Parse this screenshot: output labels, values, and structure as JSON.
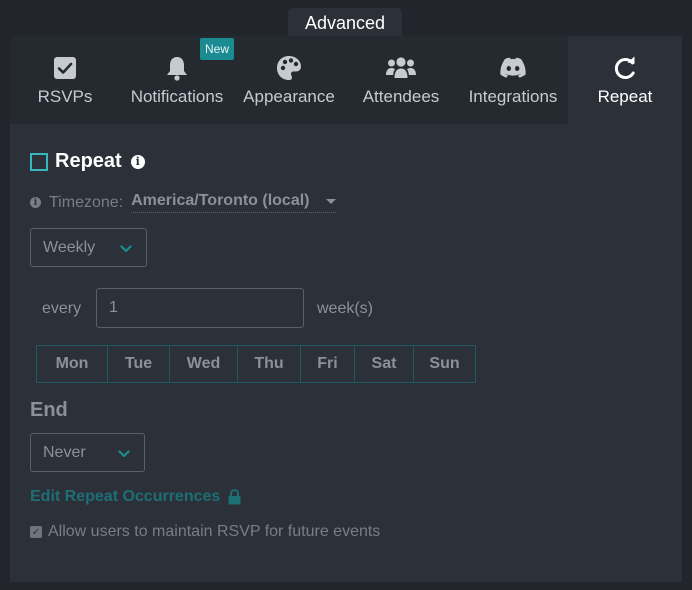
{
  "header": {
    "section_tab": "Advanced"
  },
  "tabs": [
    {
      "label": "RSVPs",
      "icon": "checkbox-icon"
    },
    {
      "label": "Notifications",
      "icon": "bell-icon",
      "badge": "New"
    },
    {
      "label": "Appearance",
      "icon": "palette-icon"
    },
    {
      "label": "Attendees",
      "icon": "users-icon"
    },
    {
      "label": "Integrations",
      "icon": "discord-icon"
    },
    {
      "label": "Repeat",
      "icon": "redo-icon",
      "active": true
    }
  ],
  "repeat": {
    "title": "Repeat",
    "checked": false,
    "info_glyph": "i",
    "timezone_label": "Timezone:",
    "timezone_value": "America/Toronto (local)",
    "frequency": "Weekly",
    "every_label": "every",
    "every_value": "1",
    "unit_label": "week(s)",
    "days": [
      "Mon",
      "Tue",
      "Wed",
      "Thu",
      "Fri",
      "Sat",
      "Sun"
    ],
    "end_label": "End",
    "end_value": "Never",
    "edit_link": "Edit Repeat Occurrences",
    "allow_label": "Allow users to maintain RSVP for future events",
    "allow_checked": true
  },
  "colors": {
    "background": "#22252b",
    "panel": "#2c3039",
    "tabbar": "#252930",
    "accent": "#1a8c91",
    "link": "#1c6f74",
    "muted_text": "#8b919b"
  }
}
